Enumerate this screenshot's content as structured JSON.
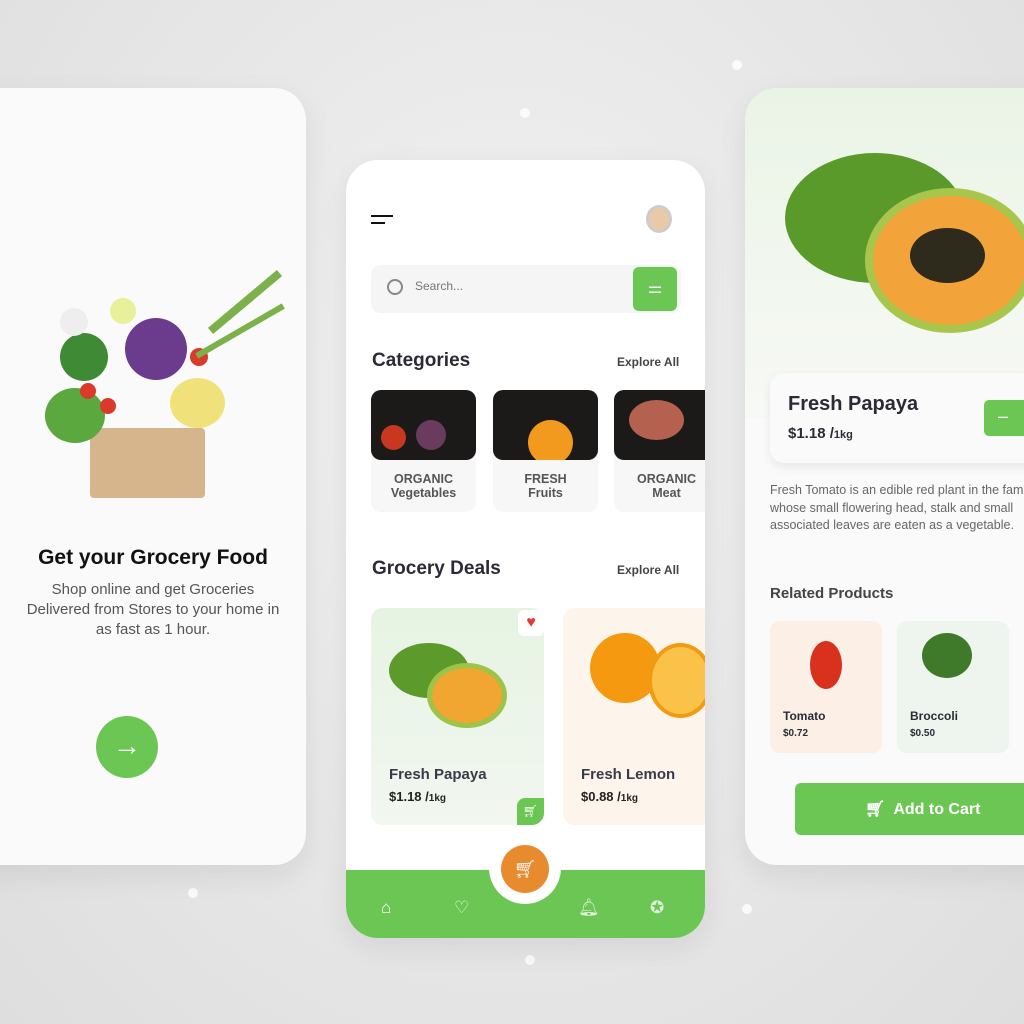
{
  "onboarding": {
    "title": "Get your Grocery Food",
    "subtitle_lines": [
      "Shop online and get Groceries",
      "Delivered from Stores to your home in",
      "as fast as 1 hour."
    ],
    "next_icon": "arrow-right-icon"
  },
  "home": {
    "search_placeholder": "Search...",
    "categories_title": "Categories",
    "categories_explore": "Explore All",
    "categories": [
      {
        "line1": "ORGANIC",
        "line2": "Vegetables"
      },
      {
        "line1": "FRESH",
        "line2": "Fruits"
      },
      {
        "line1": "ORGANIC",
        "line2": "Meat"
      }
    ],
    "deals_title": "Grocery Deals",
    "deals_explore": "Explore All",
    "deals": [
      {
        "name": "Fresh Papaya",
        "price": "$1.18 /",
        "unit": "1kg"
      },
      {
        "name": "Fresh Lemon",
        "price": "$0.88 /",
        "unit": "1kg"
      }
    ],
    "nav": [
      "home-icon",
      "heart-icon",
      "cart-icon",
      "bell-icon",
      "discount-icon"
    ]
  },
  "detail": {
    "name": "Fresh Papaya",
    "price": "$1.18 /",
    "unit": "1kg",
    "qty_minus": "–",
    "description": "Fresh Tomato is an edible red plant in the family whose small flowering head, stalk and small associated leaves are eaten as a vegetable.",
    "related_title": "Related Products",
    "related": [
      {
        "name": "Tomato",
        "price": "$0.72"
      },
      {
        "name": "Broccoli",
        "price": "$0.50"
      }
    ],
    "add_to_cart": "Add to Cart"
  },
  "colors": {
    "accent": "#6cc654",
    "orange": "#e88a2e",
    "heart": "#e53935"
  }
}
